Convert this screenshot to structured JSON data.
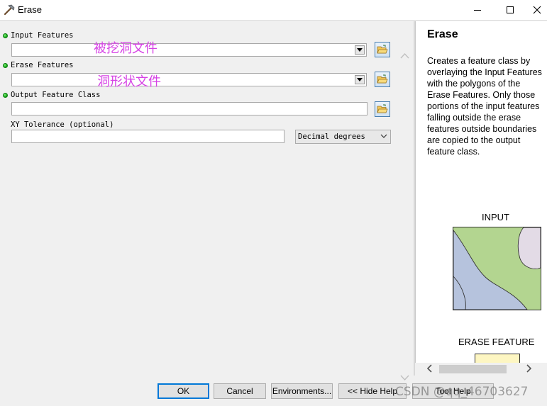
{
  "window": {
    "title": "Erase"
  },
  "params": {
    "input_features": {
      "label": "Input Features",
      "value": ""
    },
    "erase_features": {
      "label": "Erase Features",
      "value": ""
    },
    "output_feature_class": {
      "label": "Output Feature Class",
      "value": ""
    },
    "xy_tolerance": {
      "label": "XY Tolerance (optional)",
      "value": "",
      "unit": "Decimal degrees"
    }
  },
  "annotations": {
    "input_note": "被挖洞文件",
    "erase_note": "洞形状文件"
  },
  "help": {
    "title": "Erase",
    "description": "Creates a feature class by overlaying the Input Features with the polygons of the Erase Features. Only those portions of the input features falling outside the erase features outside boundaries are copied to the output feature class.",
    "input_caption": "INPUT",
    "erase_caption": "ERASE FEATURE"
  },
  "buttons": {
    "ok": "OK",
    "cancel": "Cancel",
    "environments": "Environments...",
    "hide_help": "<< Hide Help",
    "tool_help": "Tool Help"
  },
  "watermark": "CSDN @qq_46703627",
  "colors": {
    "required_dot": "#11a414",
    "annotation": "#d642e5",
    "map_green": "#b3d590",
    "map_blue": "#b6c3dd",
    "map_lilac": "#e3dbe6",
    "erase_yellow": "#fdf6c2"
  }
}
